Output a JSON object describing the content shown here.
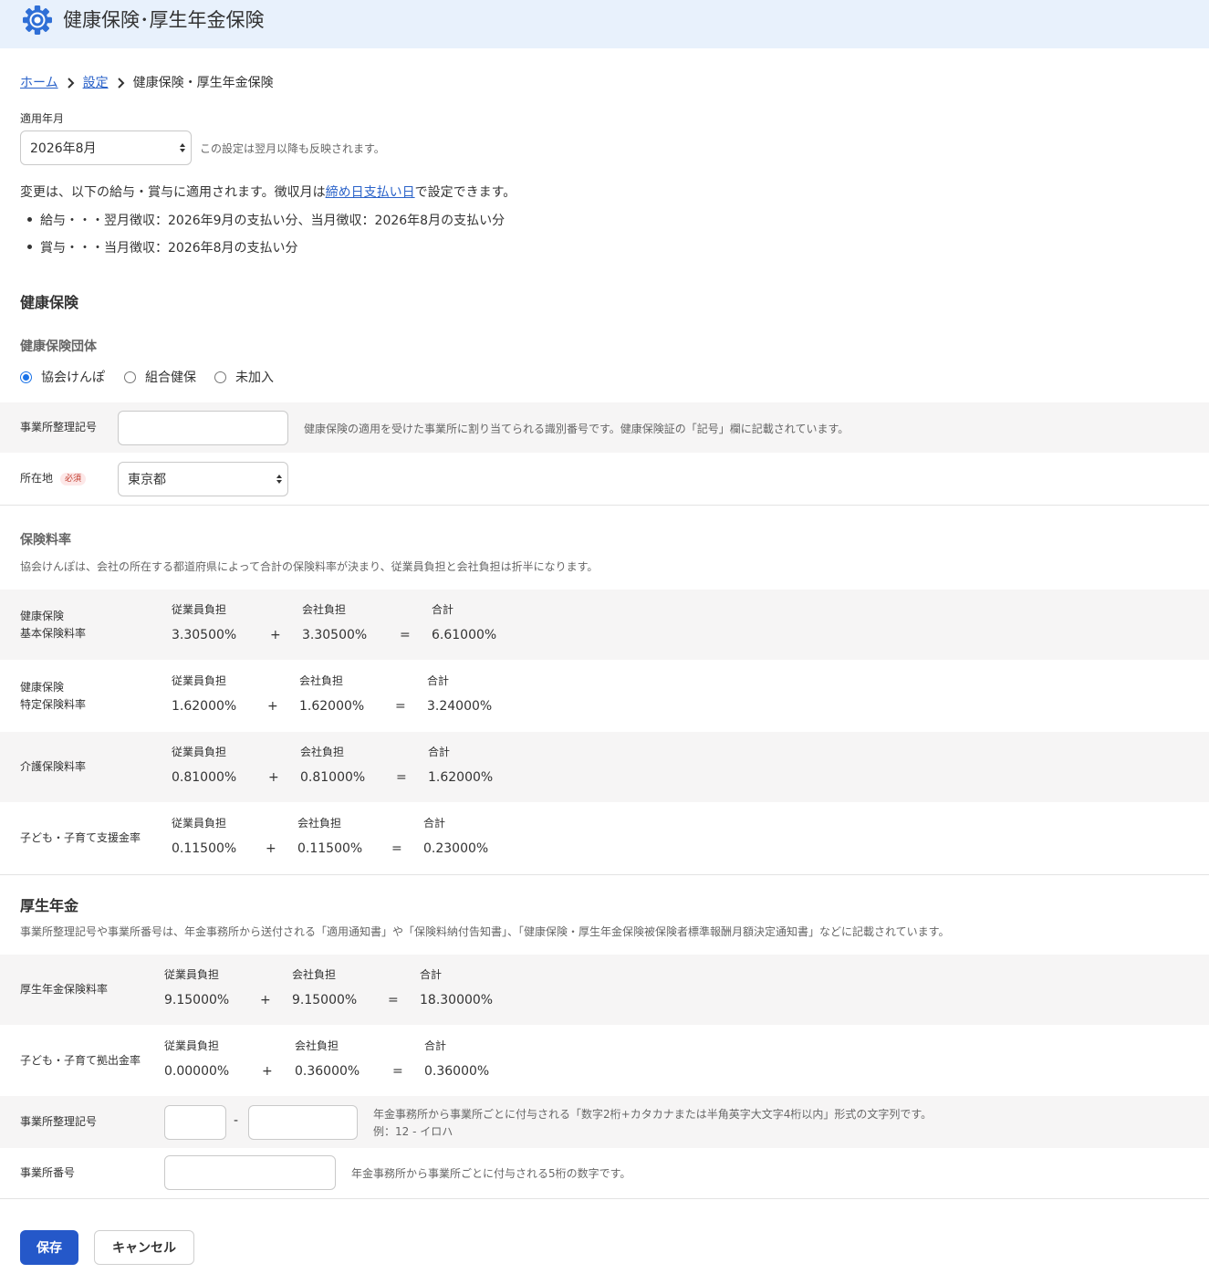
{
  "header": {
    "title": "健康保険･厚生年金保険"
  },
  "breadcrumb": {
    "home": "ホーム",
    "settings": "設定",
    "current": "健康保険・厚生年金保険"
  },
  "period": {
    "label": "適用年月",
    "selected": "2026年8月",
    "hint": "この設定は翌月以降も反映されます。"
  },
  "notice": {
    "pre": "変更は、以下の給与・賞与に適用されます。徴収月は",
    "link": "締め日支払い日",
    "post": "で設定できます。",
    "items": [
      "給与・・・翌月徴収：2026年9月の支払い分、当月徴収：2026年8月の支払い分",
      "賞与・・・当月徴収：2026年8月の支払い分"
    ]
  },
  "health": {
    "title": "健康保険",
    "org_title": "健康保険団体",
    "org_options": [
      "協会けんぽ",
      "組合健保",
      "未加入"
    ],
    "org_selected": 0,
    "office_code_label": "事業所整理記号",
    "office_code_value": "",
    "office_code_hint": "健康保険の適用を受けた事業所に割り当てられる識別番号です。健康保険証の「記号」欄に記載されています。",
    "location_label": "所在地",
    "required_badge": "必須",
    "location_value": "東京都",
    "rate_title": "保険料率",
    "rate_desc": "協会けんぽは、会社の所在する都道府県によって合計の保険料率が決まり、従業員負担と会社負担は折半になります。"
  },
  "col_labels": {
    "employee": "従業員負担",
    "company": "会社負担",
    "total": "合計",
    "plus": "+",
    "equals": "="
  },
  "health_rates": [
    {
      "label1": "健康保険",
      "label2": "基本保険料率",
      "employee": "3.30500%",
      "company": "3.30500%",
      "total": "6.61000%"
    },
    {
      "label1": "健康保険",
      "label2": "特定保険料率",
      "employee": "1.62000%",
      "company": "1.62000%",
      "total": "3.24000%"
    },
    {
      "label1": "介護保険料率",
      "label2": "",
      "employee": "0.81000%",
      "company": "0.81000%",
      "total": "1.62000%"
    },
    {
      "label1": "子ども・子育て支援金率",
      "label2": "",
      "employee": "0.11500%",
      "company": "0.11500%",
      "total": "0.23000%"
    }
  ],
  "pension": {
    "title": "厚生年金",
    "desc": "事業所整理記号や事業所番号は、年金事務所から送付される「適用通知書」や「保険料納付告知書」、「健康保険・厚生年金保険被保険者標準報酬月額決定通知書」などに記載されています。",
    "rates": [
      {
        "label1": "厚生年金保険料率",
        "employee": "9.15000%",
        "company": "9.15000%",
        "total": "18.30000%"
      },
      {
        "label1": "子ども・子育て拠出金率",
        "employee": "0.00000%",
        "company": "0.36000%",
        "total": "0.36000%"
      }
    ],
    "office_code_label": "事業所整理記号",
    "office_code_part1": "",
    "office_code_part2": "",
    "office_code_sep": "-",
    "office_code_hint1": "年金事務所から事業所ごとに付与される「数字2桁+カタカナまたは半角英字大文字4桁以内」形式の文字列です。",
    "office_code_hint2": "例：12 - イロハ",
    "office_number_label": "事業所番号",
    "office_number_value": "",
    "office_number_hint": "年金事務所から事業所ごとに付与される5桁の数字です。"
  },
  "actions": {
    "save": "保存",
    "cancel": "キャンセル"
  },
  "colors": {
    "accent": "#2558c9",
    "link": "#2a62c9",
    "header_bg": "#e8f1fc",
    "band_bg": "#f6f5f5"
  }
}
